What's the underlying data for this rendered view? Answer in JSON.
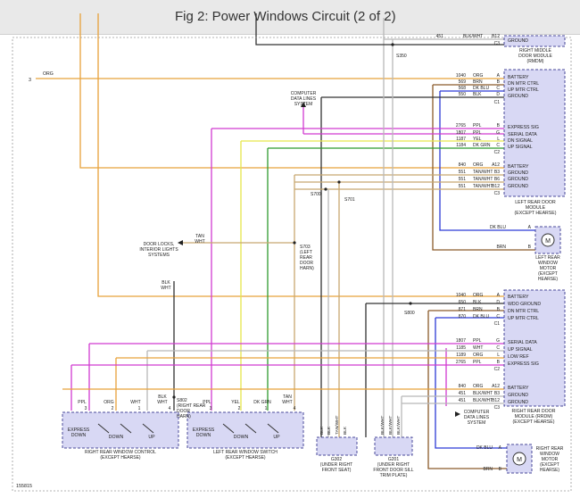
{
  "header": {
    "title": "Fig 2: Power Windows Circuit (2 of 2)"
  },
  "figure_id": "155815",
  "colors": {
    "org": "#e8a23a",
    "ppl": "#d13ad1",
    "yel": "#e6e64a",
    "dk_grn": "#2e9a2e",
    "dk_blu": "#2c3ad6",
    "brn": "#8a5a2a",
    "tan": "#c8a870",
    "wht": "#b8b8b8",
    "blk": "#333333",
    "module_fill": "#d8d8f4",
    "module_stroke": "#4a4a9a"
  },
  "labels": {
    "wire_3": "3",
    "wire_org": "ORG",
    "rmdm_title": [
      "RIGHT MIDDLE",
      "DOOR MODULE",
      "(RMDM)"
    ],
    "rmdm_ground": "GROUND",
    "rmdm_wire": [
      "451",
      "BLK/WHT",
      "B12",
      "C3"
    ],
    "s350": "S350",
    "lrdm_pins": [
      "BATTERY",
      "DN MTR CTRL",
      "UP MTR CTRL",
      "GROUND",
      "EXPRESS SIG",
      "SERIAL DATA",
      "DN SIGNAL",
      "UP SIGNAL",
      "BATTERY",
      "GROUND",
      "GROUND",
      "GROUND"
    ],
    "lrdm_conn": [
      "A",
      "B",
      "C",
      "D",
      "C1",
      "B",
      "G",
      "L",
      "C",
      "C2",
      "A12",
      "B3",
      "B6",
      "B12",
      "C3"
    ],
    "lrdm_title": [
      "LEFT REAR DOOR",
      "MODULE",
      "(EXCEPT HEARSE)"
    ],
    "lrdm_wires": [
      [
        "1040",
        "ORG"
      ],
      [
        "569",
        "BRN"
      ],
      [
        "568",
        "DK BLU"
      ],
      [
        "550",
        "BLK"
      ],
      [
        "2765",
        "PPL"
      ],
      [
        "1807",
        "PPL"
      ],
      [
        "1187",
        "YEL"
      ],
      [
        "1184",
        "DK GRN"
      ],
      [
        "840",
        "ORG"
      ],
      [
        "551",
        "TAN/WHT"
      ],
      [
        "551",
        "TAN/WHT"
      ],
      [
        "551",
        "TAN/WHT"
      ]
    ],
    "computer_data_lines_1": [
      "COMPUTER",
      "DATA LINES",
      "SYSTEM"
    ],
    "s700": "S700",
    "s701": "S701",
    "s703": [
      "S703",
      "(LEFT",
      "REAR",
      "DOOR",
      "HARN)"
    ],
    "door_locks": [
      "DOOR LOCKS,",
      "INTERIOR LIGHTS",
      "SYSTEMS"
    ],
    "tan_wht": [
      "TAN",
      "WHT"
    ],
    "blk_wht": [
      "BLK",
      "WHT"
    ],
    "lr_motor_wires": [
      [
        "DK BLU",
        "A"
      ],
      [
        "BRN",
        "B"
      ]
    ],
    "lr_motor_title": [
      "LEFT REAR",
      "WINDOW",
      "MOTOR",
      "(EXCEPT",
      "HEARSE)"
    ],
    "motor_symbol": "M",
    "rrdm_pins": [
      "BATTERY",
      "WDO GROUND",
      "DN MTR CTRL",
      "UP MTR CTRL",
      "SERIAL DATA",
      "UP SIGNAL",
      "LOW REF",
      "EXPRESS SIG",
      "BATTERY",
      "GROUND",
      "GROUND"
    ],
    "rrdm_conn": [
      "A",
      "D",
      "B",
      "C",
      "C1",
      "G",
      "C",
      "L",
      "B",
      "C2",
      "A12",
      "B3",
      "B12",
      "C3"
    ],
    "rrdm_wires": [
      [
        "1040",
        "ORG"
      ],
      [
        "650",
        "BLK"
      ],
      [
        "871",
        "BRN"
      ],
      [
        "870",
        "DK BLU"
      ],
      [
        "1807",
        "PPL"
      ],
      [
        "1185",
        "WHT"
      ],
      [
        "1189",
        "ORG"
      ],
      [
        "2765",
        "PPL"
      ],
      [
        "840",
        "ORG"
      ],
      [
        "451",
        "BLK/WHT"
      ],
      [
        "451",
        "BLK/WHT"
      ]
    ],
    "rrdm_title": [
      "RIGHT REAR DOOR",
      "MODULE (RRDM)",
      "(EXCEPT HEARSE)"
    ],
    "s800": "S800",
    "computer_data_lines_2": [
      "COMPUTER",
      "DATA LINES",
      "SYSTEM"
    ],
    "rr_motor_wires": [
      [
        "DK BLU",
        "A"
      ],
      [
        "BRN",
        "B"
      ]
    ],
    "rr_motor_title": [
      "RIGHT REAR",
      "WINDOW",
      "MOTOR",
      "(EXCEPT",
      "HEARSE)"
    ],
    "s802": [
      "S802",
      "(RIGHT REAR",
      "DOOR",
      "HARN)"
    ],
    "rr_switch_wires": [
      [
        "PPL",
        "3"
      ],
      [
        "ORG",
        "2"
      ],
      [
        "WHT",
        "1"
      ],
      [
        "BLK",
        "WHT",
        "4"
      ]
    ],
    "rr_switch": {
      "express": [
        "EXPRESS",
        "DOWN"
      ],
      "down": "DOWN",
      "up": "UP",
      "title": [
        "RIGHT REAR WINDOW CONTROL",
        "(EXCEPT HEARSE)"
      ]
    },
    "lr_switch_wires": [
      [
        "PPL",
        "3"
      ],
      [
        "YEL",
        "2"
      ],
      [
        "DK GRN",
        "1"
      ],
      [
        "TAN",
        "WHT",
        "4"
      ]
    ],
    "lr_switch": {
      "express": [
        "EXPRESS",
        "DOWN"
      ],
      "down": "DOWN",
      "up": "UP",
      "title": [
        "LEFT REAR WINDOW SWITCH",
        "(EXCEPT HEARSE)"
      ]
    },
    "g302_wires": [
      "BLK",
      "BLK",
      "TAN/WHT",
      "BLK"
    ],
    "g302": [
      "G302",
      "(UNDER RIGHT",
      "FRONT SEAT)"
    ],
    "g201_wires": [
      "BLK/WHT",
      "BLK/WHT",
      "BLK/WHT"
    ],
    "g201": [
      "G201",
      "(UNDER RIGHT",
      "FRONT DOOR SILL",
      "TRIM PLATE)"
    ]
  }
}
